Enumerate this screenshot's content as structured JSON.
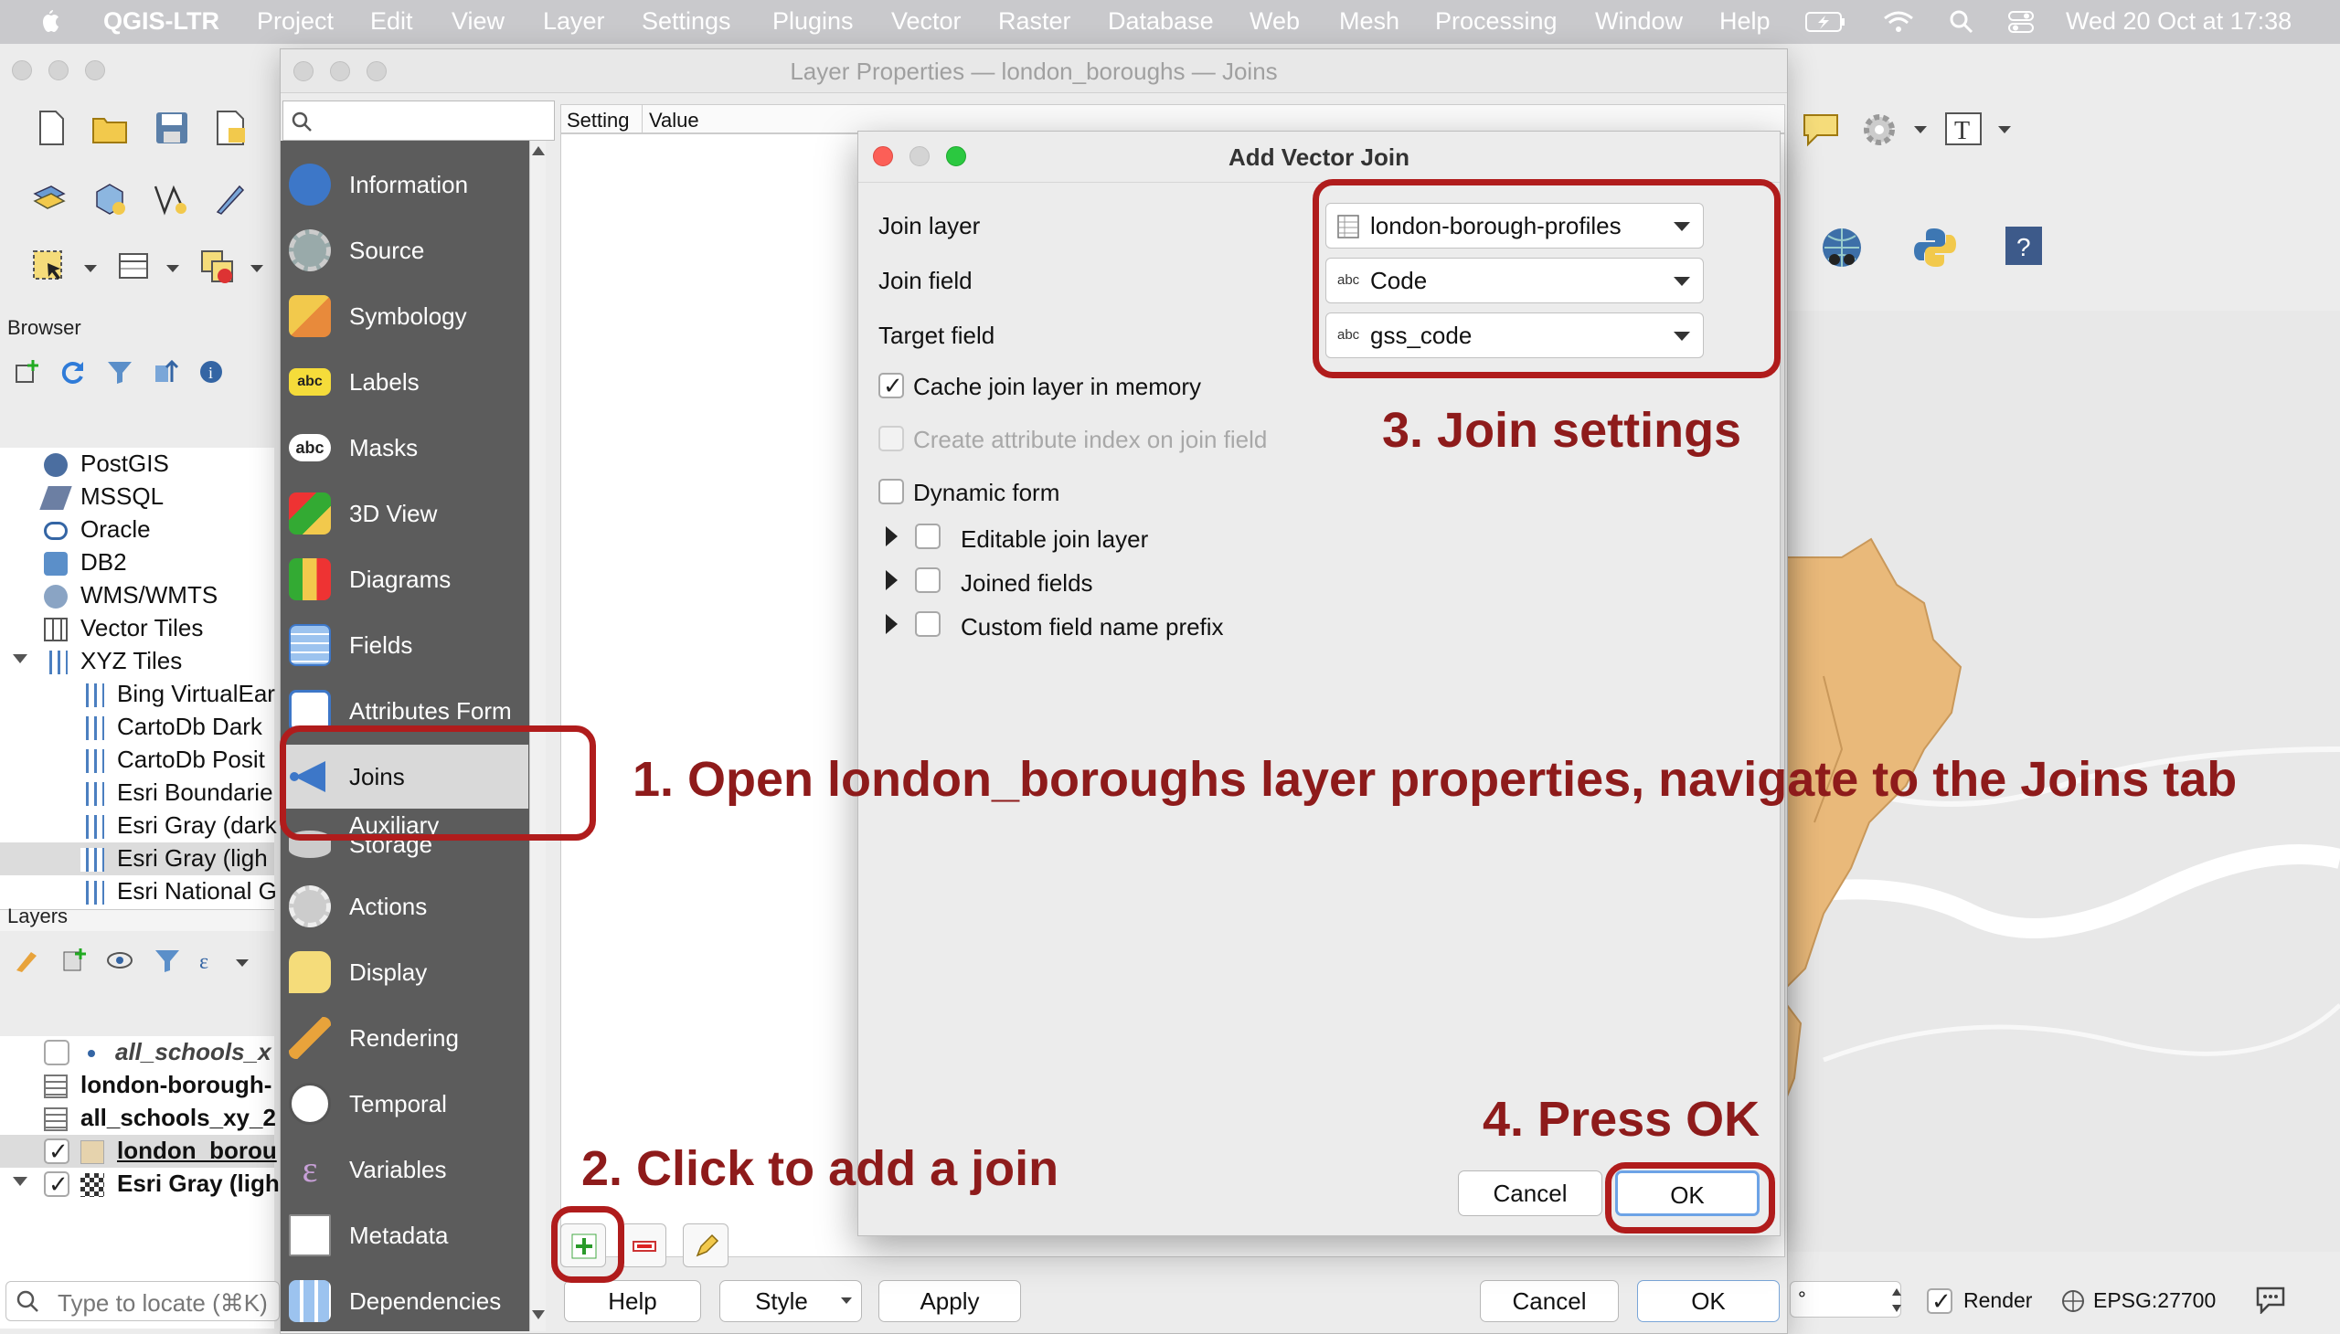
{
  "menubar": {
    "app": "QGIS-LTR",
    "items": [
      "Project",
      "Edit",
      "View",
      "Layer",
      "Settings",
      "Plugins",
      "Vector",
      "Raster",
      "Database",
      "Web",
      "Mesh",
      "Processing",
      "Window",
      "Help"
    ],
    "clock": "Wed 20 Oct at  17:38"
  },
  "browser": {
    "title": "Browser",
    "items": [
      "PostGIS",
      "MSSQL",
      "Oracle",
      "DB2",
      "WMS/WMTS",
      "Vector Tiles",
      "XYZ Tiles",
      "Bing VirtualEar",
      "CartoDb Dark",
      "CartoDb Posit",
      "Esri Boundarie",
      "Esri Gray (dark",
      "Esri Gray (ligh",
      "Esri National G"
    ]
  },
  "layers": {
    "title": "Layers",
    "items": [
      "all_schools_x",
      "london-borough-",
      "all_schools_xy_2",
      "london_borou",
      "Esri Gray (ligh"
    ]
  },
  "locator": {
    "placeholder": "Type to locate (⌘K)"
  },
  "statusbar": {
    "render": "Render",
    "crs": "EPSG:27700",
    "degree": "°"
  },
  "layer_props": {
    "title": "Layer Properties — london_boroughs — Joins",
    "col_setting": "Setting",
    "col_value": "Value",
    "sidebar": [
      "Information",
      "Source",
      "Symbology",
      "Labels",
      "Masks",
      "3D View",
      "Diagrams",
      "Fields",
      "Attributes Form",
      "Joins",
      "Auxiliary",
      "Storage",
      "Actions",
      "Display",
      "Rendering",
      "Temporal",
      "Variables",
      "Metadata",
      "Dependencies"
    ],
    "buttons": {
      "help": "Help",
      "style": "Style",
      "apply": "Apply",
      "cancel": "Cancel",
      "ok": "OK"
    }
  },
  "dialog": {
    "title": "Add Vector Join",
    "join_layer_label": "Join layer",
    "join_layer_value": "london-borough-profiles",
    "join_field_label": "Join field",
    "join_field_value": "Code",
    "target_field_label": "Target field",
    "target_field_value": "gss_code",
    "field_type": "abc",
    "cache_label": "Cache join layer in memory",
    "index_label": "Create attribute index on join field",
    "dynamic_label": "Dynamic form",
    "editable_label": "Editable join layer",
    "joined_fields_label": "Joined fields",
    "prefix_label": "Custom field name prefix",
    "cancel": "Cancel",
    "ok": "OK"
  },
  "annotations": {
    "step1": "1. Open london_boroughs layer properties, navigate to the Joins tab",
    "step2": "2. Click to add a join",
    "step3": "3. Join settings",
    "step4": "4. Press OK"
  },
  "colors": {
    "annotation": "#8e1b1b",
    "box": "#b01c1c",
    "borough_fill": "#e9b97a",
    "sidebar": "#5c5c5c"
  }
}
